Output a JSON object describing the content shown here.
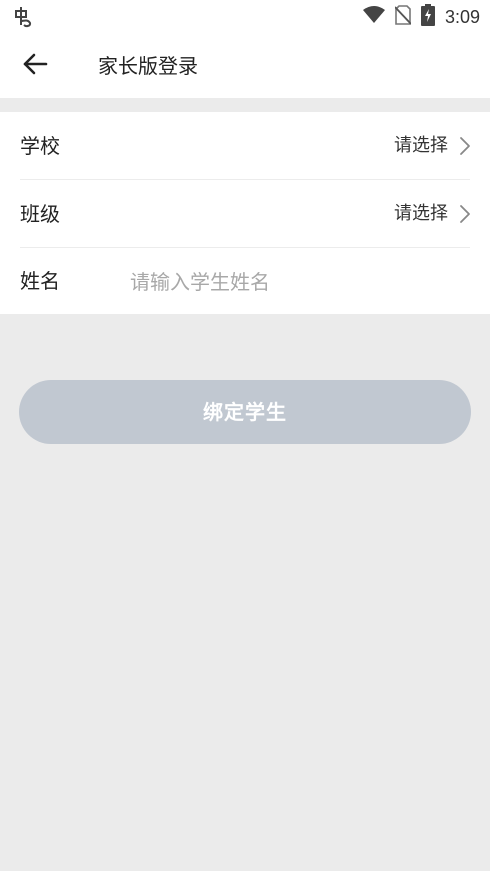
{
  "status_bar": {
    "time": "3:09",
    "icons": [
      "app-notification-icon",
      "wifi-icon",
      "no-sim-icon",
      "battery-charging-icon"
    ]
  },
  "header": {
    "title": "家长版登录",
    "back_icon": "arrow-left-icon"
  },
  "form": {
    "school": {
      "label": "学校",
      "value": "请选择"
    },
    "class": {
      "label": "班级",
      "value": "请选择"
    },
    "name": {
      "label": "姓名",
      "placeholder": "请输入学生姓名",
      "value": ""
    }
  },
  "actions": {
    "bind_label": "绑定学生"
  },
  "colors": {
    "background": "#ebebeb",
    "button_disabled": "#c1c8d1",
    "placeholder": "#a8a8a8"
  }
}
